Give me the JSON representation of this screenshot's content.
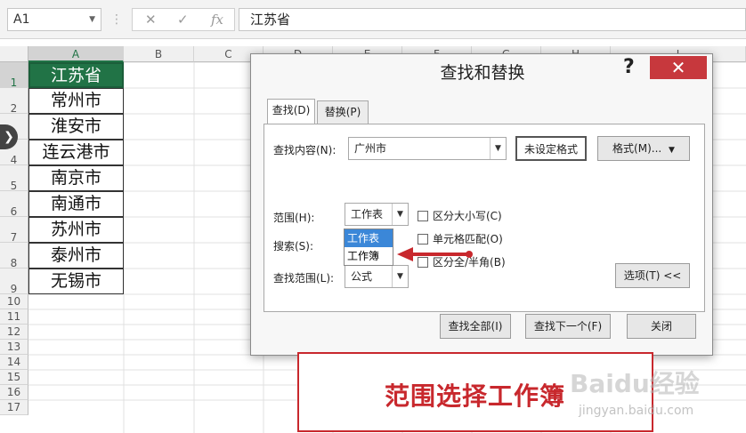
{
  "formula_bar": {
    "name_box": "A1",
    "cancel_glyph": "✕",
    "enter_glyph": "✓",
    "fx_glyph": "fx",
    "content": "江苏省"
  },
  "columns": [
    "A",
    "B",
    "C",
    "D",
    "E",
    "F",
    "G",
    "H",
    "I"
  ],
  "rows": [
    "1",
    "2",
    "3",
    "4",
    "5",
    "6",
    "7",
    "8",
    "9",
    "10",
    "11",
    "12",
    "13",
    "14",
    "15",
    "16",
    "17"
  ],
  "cells": [
    "江苏省",
    "常州市",
    "淮安市",
    "连云港市",
    "南京市",
    "南通市",
    "苏州市",
    "泰州市",
    "无锡市"
  ],
  "dialog": {
    "title": "查找和替换",
    "help": "?",
    "close": "✕",
    "tabs": {
      "find": "查找(D)",
      "replace": "替换(P)"
    },
    "find_label": "查找内容(N):",
    "find_value": "广州市",
    "format_status": "未设定格式",
    "format_button": "格式(M)...",
    "scope_label": "范围(H):",
    "scope_value": "工作表",
    "scope_options": [
      "工作表",
      "工作簿"
    ],
    "search_label": "搜索(S):",
    "lookin_label": "查找范围(L):",
    "lookin_value": "公式",
    "options": {
      "match_case": "区分大小写(C)",
      "match_cell": "单元格匹配(O)",
      "match_width": "区分全/半角(B)"
    },
    "options_button": "选项(T) <<",
    "find_all": "查找全部(I)",
    "find_next": "查找下一个(F)",
    "close_button": "关闭"
  },
  "caption": "范围选择工作簿",
  "watermark": {
    "brand": "Baidu经验",
    "url": "jingyan.baidu.com"
  },
  "colors": {
    "excel_green": "#217346",
    "accent_red": "#c8282d",
    "highlight_blue": "#3b87d8"
  }
}
